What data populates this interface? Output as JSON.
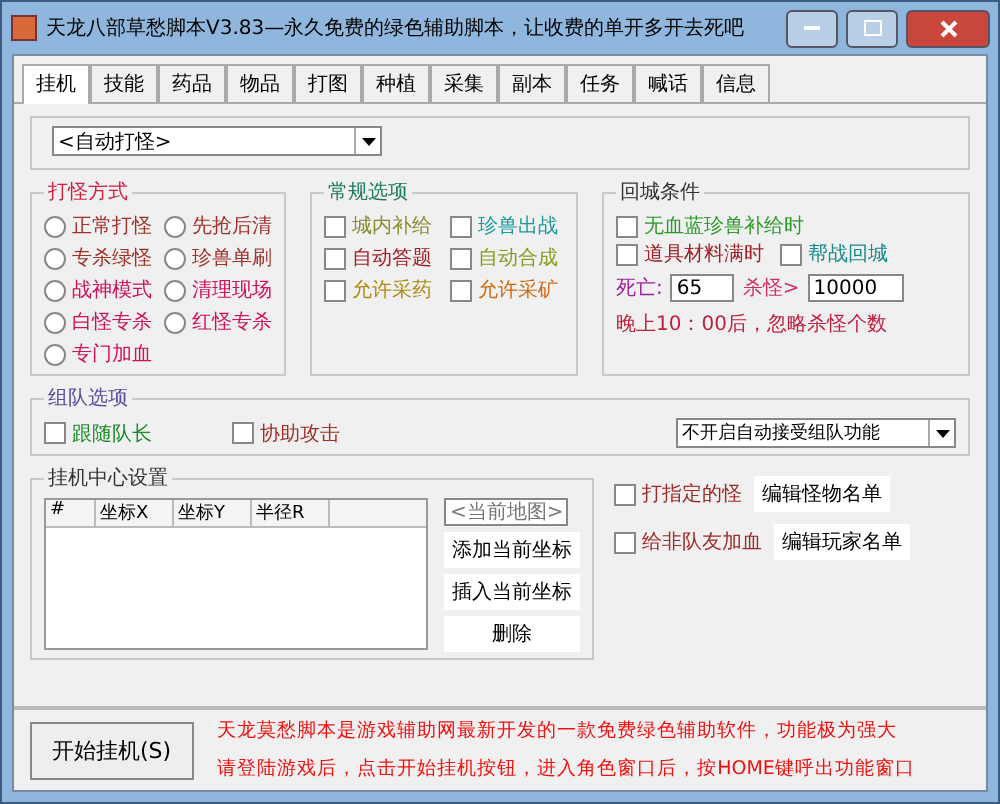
{
  "window": {
    "title": "天龙八部草愁脚本V3.83—永久免费的绿色辅助脚本，让收费的单开多开去死吧"
  },
  "tabs": [
    {
      "label": "挂机",
      "selected": true
    },
    {
      "label": "技能",
      "selected": false
    },
    {
      "label": "药品",
      "selected": false
    },
    {
      "label": "物品",
      "selected": false
    },
    {
      "label": "打图",
      "selected": false
    },
    {
      "label": "种植",
      "selected": false
    },
    {
      "label": "采集",
      "selected": false
    },
    {
      "label": "副本",
      "selected": false
    },
    {
      "label": "任务",
      "selected": false
    },
    {
      "label": "喊话",
      "selected": false
    },
    {
      "label": "信息",
      "selected": false
    }
  ],
  "mode_select": {
    "value": "<自动打怪>"
  },
  "attack_mode": {
    "title": "打怪方式",
    "options": [
      {
        "label": "正常打怪",
        "selected": false,
        "color": "#a0302a"
      },
      {
        "label": "先抢后清",
        "selected": false,
        "color": "#a0302a"
      },
      {
        "label": "专杀绿怪",
        "selected": false,
        "color": "#a0302a"
      },
      {
        "label": "珍兽单刷",
        "selected": false,
        "color": "#a0302a"
      },
      {
        "label": "战神模式",
        "selected": false,
        "color": "#d0105a"
      },
      {
        "label": "清理现场",
        "selected": false,
        "color": "#d0105a"
      },
      {
        "label": "白怪专杀",
        "selected": false,
        "color": "#d0105a"
      },
      {
        "label": "红怪专杀",
        "selected": false,
        "color": "#d0105a"
      },
      {
        "label": "专门加血",
        "selected": false,
        "color": "#d0105a"
      }
    ]
  },
  "general": {
    "title": "常规选项",
    "options": [
      {
        "label": "城内补给",
        "checked": false,
        "color": "#8a8a30"
      },
      {
        "label": "珍兽出战",
        "checked": false,
        "color": "#1a9a9a"
      },
      {
        "label": "自动答题",
        "checked": false,
        "color": "#a0202a"
      },
      {
        "label": "自动合成",
        "checked": false,
        "color": "#8a9a20"
      },
      {
        "label": "允许采药",
        "checked": false,
        "color": "#b08a10"
      },
      {
        "label": "允许采矿",
        "checked": false,
        "color": "#d06a10"
      }
    ]
  },
  "return_city": {
    "title": "回城条件",
    "options": [
      {
        "label": "无血蓝珍兽补给时",
        "checked": false,
        "color": "#2a9a2a"
      },
      {
        "label": "道具材料满时",
        "checked": false,
        "color": "#a0202a"
      },
      {
        "label": "帮战回城",
        "checked": false,
        "color": "#1a8a8a"
      }
    ],
    "death_label": "死亡:",
    "death_value": "65",
    "kill_label": "杀怪>",
    "kill_value": "10000",
    "note": "晚上10：00后，忽略杀怪个数"
  },
  "team": {
    "title": "组队选项",
    "options": [
      {
        "label": "跟随队长",
        "checked": false,
        "color": "#1a8a2a"
      },
      {
        "label": "协助攻击",
        "checked": false,
        "color": "#a0302a"
      }
    ],
    "accept_select": "不开启自动接受组队功能"
  },
  "hang_center": {
    "title": "挂机中心设置",
    "columns": [
      "#",
      "坐标X",
      "坐标Y",
      "半径R"
    ],
    "map_placeholder": "<当前地图>",
    "buttons": [
      "添加当前坐标",
      "插入当前坐标",
      "删除"
    ]
  },
  "targets": [
    {
      "label": "打指定的怪",
      "checked": false,
      "button": "编辑怪物名单"
    },
    {
      "label": "给非队友加血",
      "checked": false,
      "button": "编辑玩家名单"
    }
  ],
  "start_button": "开始挂机(S)",
  "notice": [
    "天龙莫愁脚本是游戏辅助网最新开发的一款免费绿色辅助软件，功能极为强大",
    "请登陆游戏后，点击开始挂机按钮，进入角色窗口后，按HOME键呼出功能窗口"
  ]
}
